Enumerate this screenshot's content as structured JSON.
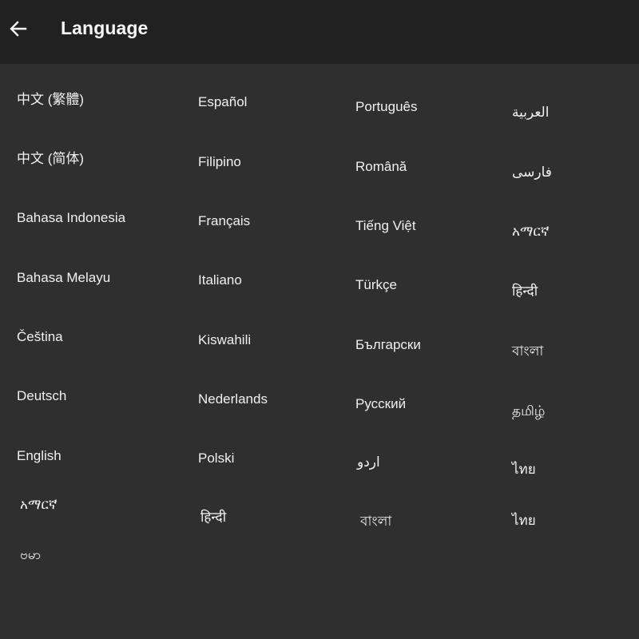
{
  "header": {
    "title": "Language",
    "back_icon": "arrow-left-icon"
  },
  "languages": {
    "col1": [
      "中文 (繁體)",
      "中文 (简体)",
      "Bahasa Indonesia",
      "Bahasa Melayu",
      "Čeština",
      "Deutsch",
      "English",
      "አማርኛ",
      "ဗမာ"
    ],
    "col2": [
      "Español",
      "Filipino",
      "Français",
      "Italiano",
      "Kiswahili",
      "Nederlands",
      "Polski",
      "हिन्दी"
    ],
    "col3": [
      "Português",
      "Română",
      "Tiếng Việt",
      "Türkçe",
      "Български",
      "Русский",
      "اردو",
      "বাংলা"
    ],
    "col4": [
      "العربية",
      "فارسی",
      "አማርኛ",
      "हिन्दी",
      "বাংলা",
      "தமிழ்",
      "ไทย",
      "ไทย"
    ]
  },
  "colors": {
    "app_bar": "#212121",
    "background": "#2f2f2f",
    "text": "#f0f0f0"
  }
}
